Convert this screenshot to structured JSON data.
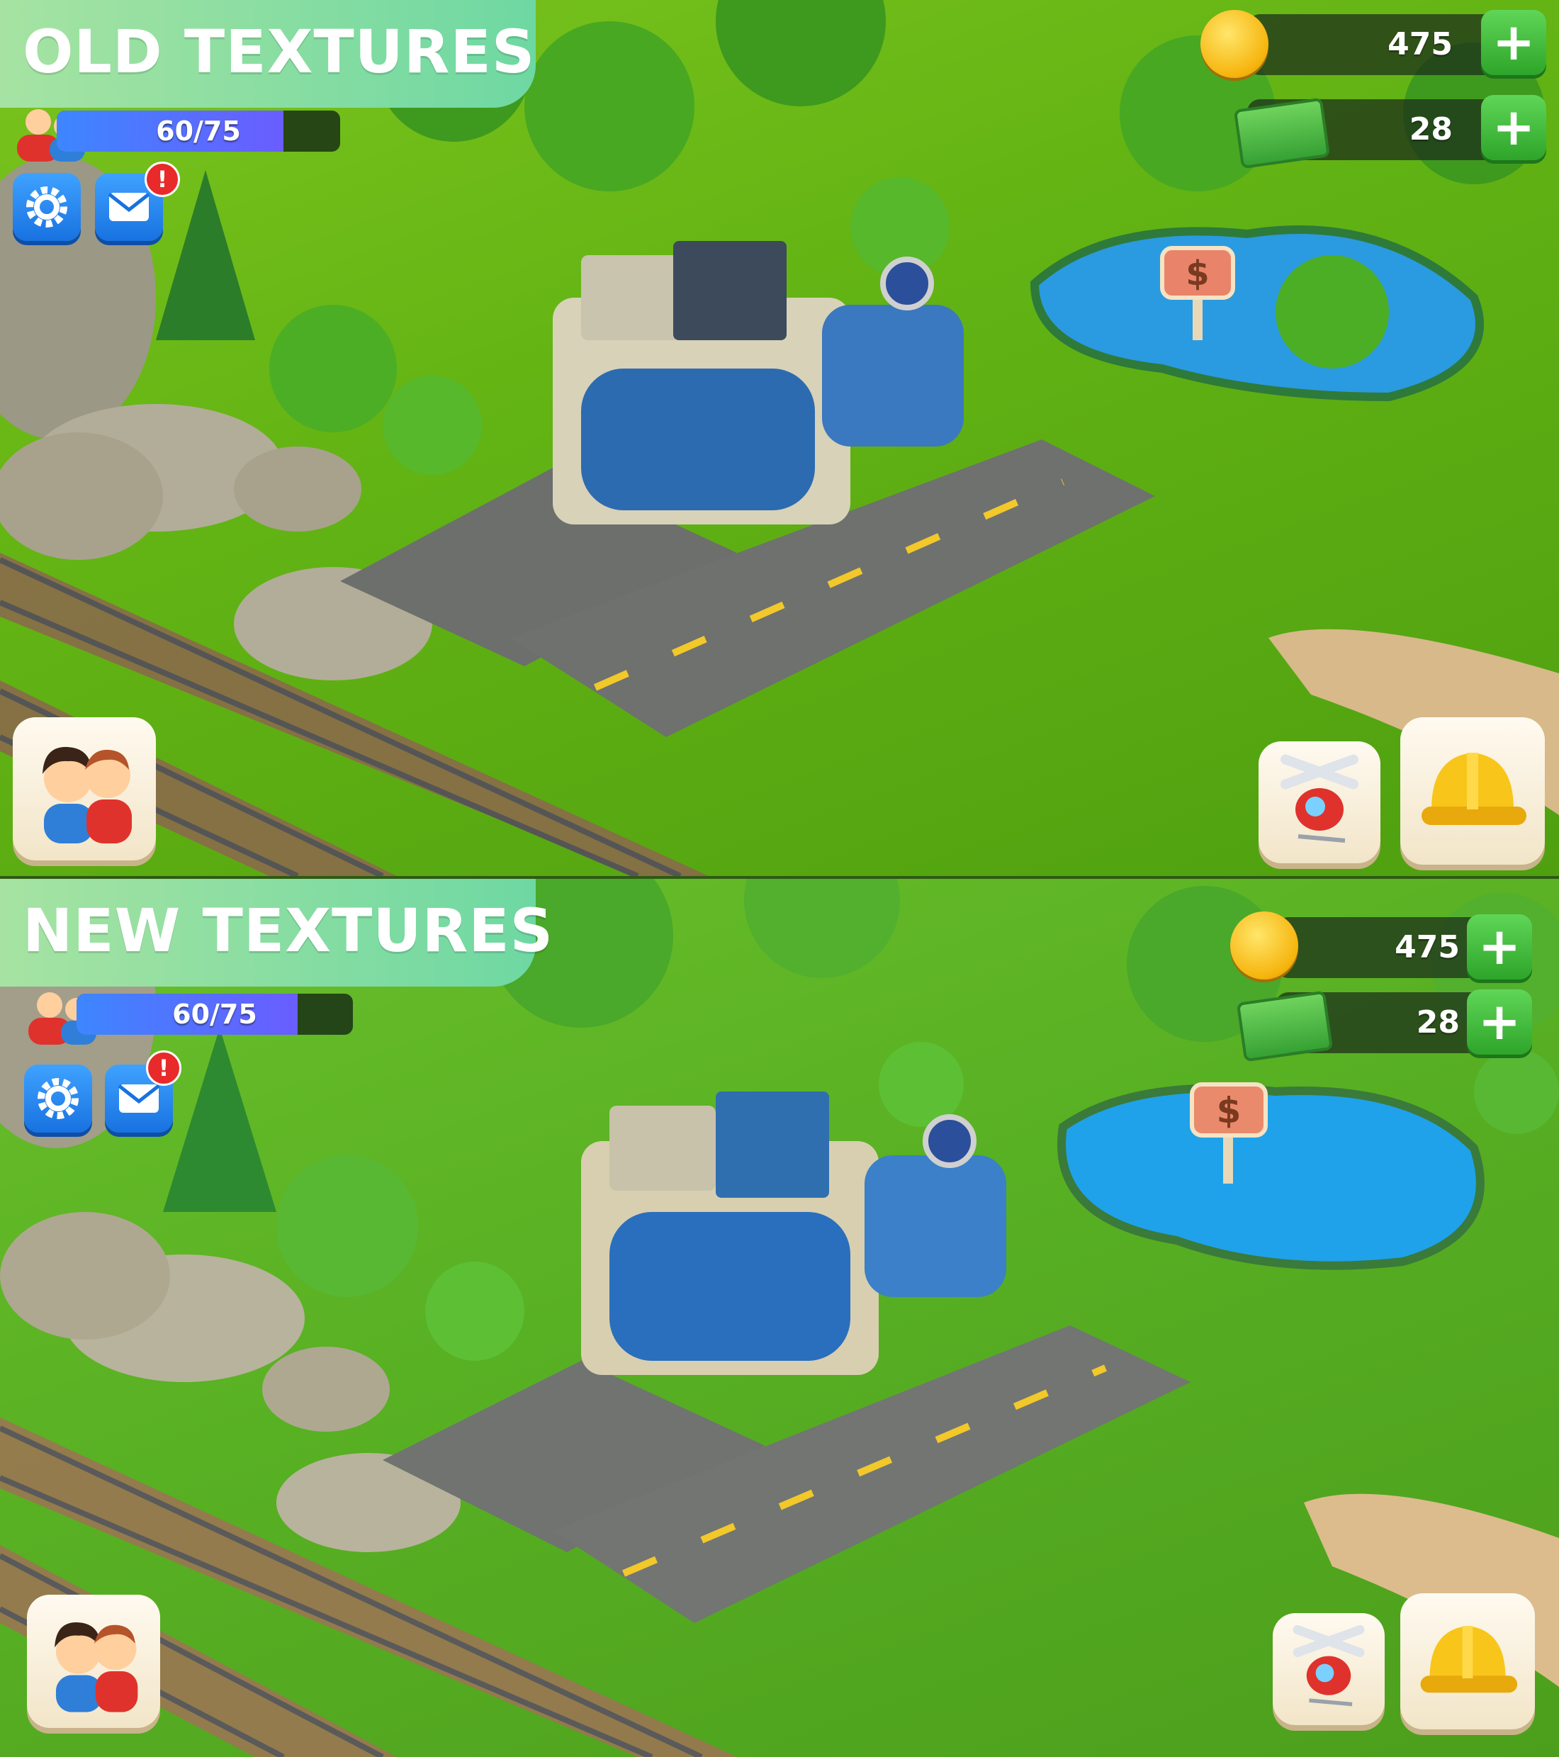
{
  "panels": [
    {
      "id": "old",
      "title": "OLD TEXTURES",
      "hud": {
        "xp": {
          "text": "60/75",
          "progress": 0.8
        },
        "coins": {
          "value": "475"
        },
        "cash": {
          "value": "28"
        },
        "settings_icon": "gear-icon",
        "mail_icon": "mail-icon",
        "mail_alert": "!",
        "friends_icon": "friends-icon",
        "helicopter_icon": "helicopter-icon",
        "build_icon": "hard-hat-icon",
        "sign_glyph": "$"
      }
    },
    {
      "id": "new",
      "title": "NEW TEXTURES",
      "hud": {
        "xp": {
          "text": "60/75",
          "progress": 0.8
        },
        "coins": {
          "value": "475"
        },
        "cash": {
          "value": "28"
        },
        "settings_icon": "gear-icon",
        "mail_icon": "mail-icon",
        "mail_alert": "!",
        "friends_icon": "friends-icon",
        "helicopter_icon": "helicopter-icon",
        "build_icon": "hard-hat-icon",
        "sign_glyph": "$"
      }
    }
  ],
  "colors": {
    "title_tab": "#8ee0a3",
    "xp_fill": "#4a7bff",
    "button_blue": "#2a8cf0",
    "plus_green": "#3cbb36",
    "coin_gold": "#f6b40d"
  }
}
